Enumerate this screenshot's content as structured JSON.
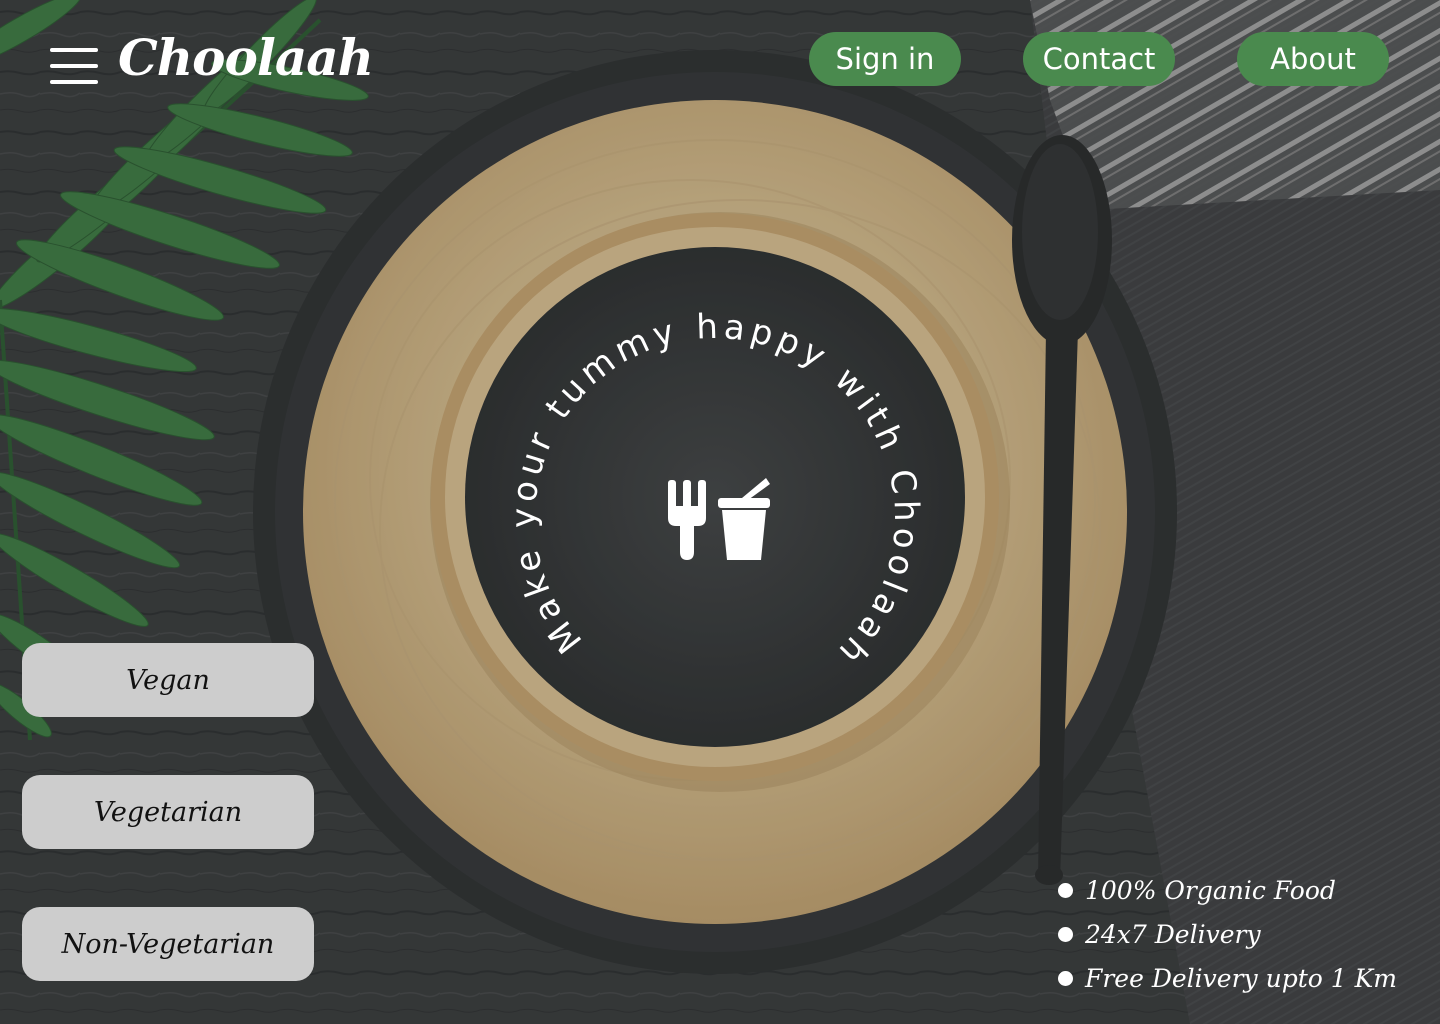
{
  "colors": {
    "accent": "#4a8a4e",
    "category_button_bg": "#cdcdcd",
    "text_light": "#ffffff",
    "table_bg": "#3b3e3e"
  },
  "header": {
    "menu_icon": "hamburger-menu-icon",
    "brand": "Choolaah",
    "nav": {
      "sign_in": "Sign in",
      "contact": "Contact",
      "about": "About"
    }
  },
  "hero": {
    "circular_text": "Make your tummy happy with Choolaah",
    "center_icon": "fork-and-drink-icon"
  },
  "categories": {
    "vegan": "Vegan",
    "vegetarian": "Vegetarian",
    "non_vegetarian": "Non-Vegetarian"
  },
  "features": [
    "100% Organic Food",
    "24x7 Delivery",
    "Free Delivery upto 1 Km"
  ]
}
